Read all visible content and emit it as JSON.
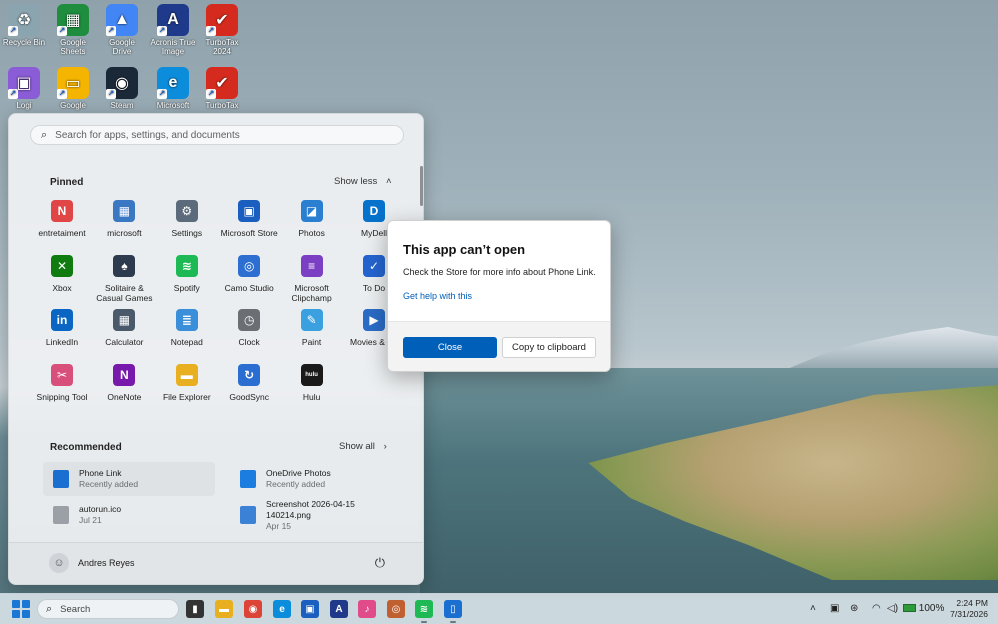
{
  "desktop": {
    "icons": [
      {
        "label": "Recycle Bin",
        "icon": "recycle-bin-icon",
        "color": "#8aa4b0",
        "glyph": "♻"
      },
      {
        "label": "Google Sheets",
        "icon": "sheets-icon",
        "color": "#1e8e3e",
        "glyph": "▦"
      },
      {
        "label": "Google Drive",
        "icon": "drive-icon",
        "color": "#4285f4",
        "glyph": "▲"
      },
      {
        "label": "Acronis True Image",
        "icon": "acronis-icon",
        "color": "#1f3a8a",
        "glyph": "A"
      },
      {
        "label": "TurboTax 2024",
        "icon": "turbotax-icon",
        "color": "#d52b1e",
        "glyph": "✔"
      },
      {
        "label": "Logi",
        "icon": "logi-icon",
        "color": "#8a5cd6",
        "glyph": "▣"
      },
      {
        "label": "Google",
        "icon": "google-slides-icon",
        "color": "#f4b400",
        "glyph": "▭"
      },
      {
        "label": "Steam",
        "icon": "steam-icon",
        "color": "#1b2838",
        "glyph": "◉"
      },
      {
        "label": "Microsoft",
        "icon": "edge-icon",
        "color": "#0c8ddb",
        "glyph": "e"
      },
      {
        "label": "TurboTax",
        "icon": "turbotax-icon",
        "color": "#d52b1e",
        "glyph": "✔"
      }
    ]
  },
  "start": {
    "search_placeholder": "Search for apps, settings, and documents",
    "pinned_title": "Pinned",
    "show_less": "Show less",
    "pinned": [
      {
        "label": "entretaiment",
        "icon": "folder-entertainment-icon",
        "color": "#e04646",
        "glyph": "N"
      },
      {
        "label": "microsoft",
        "icon": "folder-microsoft-icon",
        "color": "#3b78c4",
        "glyph": "▦"
      },
      {
        "label": "Settings",
        "icon": "settings-gear-icon",
        "color": "#5b6b7b",
        "glyph": "⚙"
      },
      {
        "label": "Microsoft Store",
        "icon": "store-icon",
        "color": "#1a5fbf",
        "glyph": "▣"
      },
      {
        "label": "Photos",
        "icon": "photos-icon",
        "color": "#2a7fd1",
        "glyph": "◪"
      },
      {
        "label": "MyDell",
        "icon": "dell-icon",
        "color": "#0672cb",
        "glyph": "D"
      },
      {
        "label": "Xbox",
        "icon": "xbox-icon",
        "color": "#107c10",
        "glyph": "✕"
      },
      {
        "label": "Solitaire & Casual Games",
        "icon": "solitaire-icon",
        "color": "#2e3b4e",
        "glyph": "♠"
      },
      {
        "label": "Spotify",
        "icon": "spotify-icon",
        "color": "#1db954",
        "glyph": "≋"
      },
      {
        "label": "Camo Studio",
        "icon": "camo-icon",
        "color": "#2d6fd0",
        "glyph": "◎"
      },
      {
        "label": "Microsoft Clipchamp",
        "icon": "clipchamp-icon",
        "color": "#7b3fc4",
        "glyph": "≡"
      },
      {
        "label": "To Do",
        "icon": "todo-icon",
        "color": "#2564cf",
        "glyph": "✓"
      },
      {
        "label": "LinkedIn",
        "icon": "linkedin-icon",
        "color": "#0a66c2",
        "glyph": "in"
      },
      {
        "label": "Calculator",
        "icon": "calculator-icon",
        "color": "#4a5a6a",
        "glyph": "▦"
      },
      {
        "label": "Notepad",
        "icon": "notepad-icon",
        "color": "#3a8fd8",
        "glyph": "≣"
      },
      {
        "label": "Clock",
        "icon": "clock-icon",
        "color": "#6b6f73",
        "glyph": "◷"
      },
      {
        "label": "Paint",
        "icon": "paint-icon",
        "color": "#3aa0e0",
        "glyph": "✎"
      },
      {
        "label": "Movies & TV",
        "icon": "movies-icon",
        "color": "#2a6cc6",
        "glyph": "▶"
      },
      {
        "label": "Snipping Tool",
        "icon": "snipping-tool-icon",
        "color": "#d94f7c",
        "glyph": "✂"
      },
      {
        "label": "OneNote",
        "icon": "onenote-icon",
        "color": "#7719aa",
        "glyph": "N"
      },
      {
        "label": "File Explorer",
        "icon": "file-explorer-icon",
        "color": "#e8b020",
        "glyph": "▬"
      },
      {
        "label": "GoodSync",
        "icon": "goodsync-icon",
        "color": "#2b6ed1",
        "glyph": "↻"
      },
      {
        "label": "Hulu",
        "icon": "hulu-icon",
        "color": "#1a1a1a",
        "glyph": "hulu"
      }
    ],
    "recommended_title": "Recommended",
    "show_all": "Show all",
    "recommended": [
      {
        "name": "Phone Link",
        "sub": "Recently added",
        "icon": "phone-link-icon",
        "color": "#1a6fd0"
      },
      {
        "name": "OneDrive Photos",
        "sub": "Recently added",
        "icon": "onedrive-icon",
        "color": "#1b7de0"
      },
      {
        "name": "autorun.ico",
        "sub": "Jul 21",
        "icon": "file-icon",
        "color": "#9aa0a6"
      },
      {
        "name": "Screenshot 2026-04-15 140214.png",
        "sub": "Apr 15",
        "icon": "image-file-icon",
        "color": "#3b82d6"
      }
    ],
    "user_name": "Andres Reyes"
  },
  "dialog": {
    "title": "This app can’t open",
    "message": "Check the Store for more info about Phone Link.",
    "help_link": "Get help with this",
    "close_label": "Close",
    "copy_label": "Copy to clipboard"
  },
  "taskbar": {
    "search_label": "Search",
    "apps": [
      {
        "icon": "task-view-icon",
        "color": "#333333",
        "glyph": "▮"
      },
      {
        "icon": "file-explorer-icon",
        "color": "#e8b020",
        "glyph": "▬"
      },
      {
        "icon": "chrome-icon",
        "color": "#db4437",
        "glyph": "◉"
      },
      {
        "icon": "edge-icon",
        "color": "#0c8ddb",
        "glyph": "e"
      },
      {
        "icon": "store-icon",
        "color": "#1a5fbf",
        "glyph": "▣"
      },
      {
        "icon": "acronis-icon",
        "color": "#1f3a8a",
        "glyph": "A"
      },
      {
        "icon": "itunes-icon",
        "color": "#e04b8a",
        "glyph": "♪"
      },
      {
        "icon": "app-icon",
        "color": "#c06030",
        "glyph": "◎"
      },
      {
        "icon": "spotify-icon",
        "color": "#1db954",
        "glyph": "≋"
      },
      {
        "icon": "phone-link-icon",
        "color": "#1a6fd0",
        "glyph": "▯"
      }
    ],
    "battery": "100%",
    "time": "2:24 PM",
    "date": "7/31/2026"
  }
}
